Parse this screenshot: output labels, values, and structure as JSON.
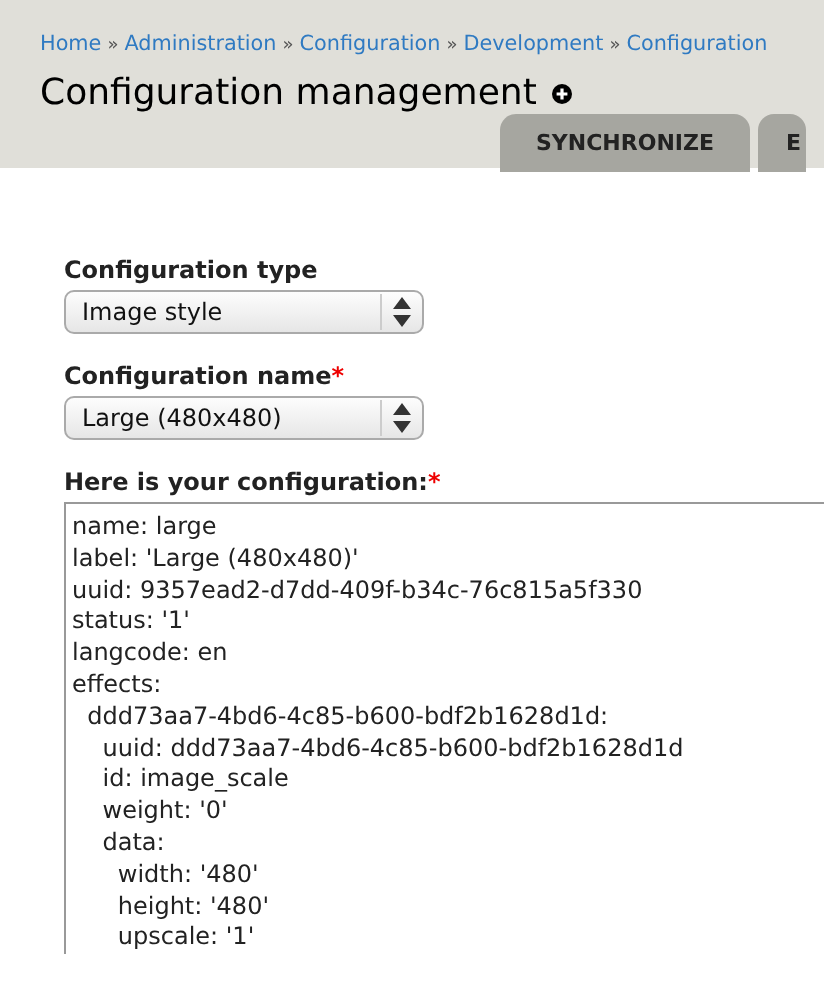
{
  "breadcrumb": {
    "items": [
      "Home",
      "Administration",
      "Configuration",
      "Development",
      "Configuration"
    ],
    "separator": "»"
  },
  "page_title": "Configuration management",
  "tabs": [
    {
      "label": "SYNCHRONIZE",
      "selected": false
    },
    {
      "label": "E",
      "selected": false
    }
  ],
  "form": {
    "type_field": {
      "label": "Configuration type",
      "required": false,
      "value": "Image style"
    },
    "name_field": {
      "label": "Configuration name",
      "required": true,
      "value": "Large (480x480)"
    },
    "config": {
      "label": "Here is your configuration:",
      "required": true,
      "value": "name: large\nlabel: 'Large (480x480)'\nuuid: 9357ead2-d7dd-409f-b34c-76c815a5f330\nstatus: '1'\nlangcode: en\neffects:\n  ddd73aa7-4bd6-4c85-b600-bdf2b1628d1d:\n    uuid: ddd73aa7-4bd6-4c85-b600-bdf2b1628d1d\n    id: image_scale\n    weight: '0'\n    data:\n      width: '480'\n      height: '480'\n      upscale: '1'"
    },
    "required_mark": "*"
  }
}
